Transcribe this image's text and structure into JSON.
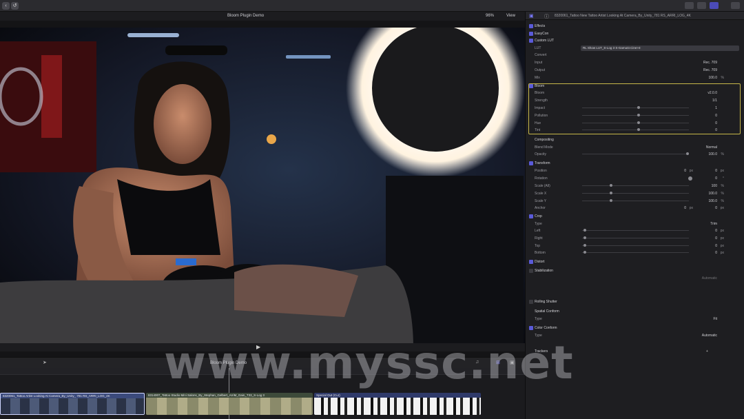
{
  "viewer": {
    "title": "Bloom Plugin Demo",
    "zoom": "96%",
    "view_label": "View"
  },
  "timeline": {
    "project_name": "Bloom Plugin Demo",
    "clips": [
      {
        "label": "8320061_Tattoo Artist Looking At Camera_By_Unity_ 781 RS_ARRI_LOG_4K"
      },
      {
        "label": "8314007_Tattoo Studio Mini Salons_By_Stephan_Gelbert_ArriM_Gain_T33_S-Log 3"
      },
      {
        "label": "Special Out (Cur)"
      }
    ]
  },
  "inspector": {
    "title": "8320061_Tattoo New Tattoo Artist Looking At Camera_By_Unity_781 RS_ARRI_LOG_4K",
    "effects_label": "Effects",
    "rows": {
      "easycon": "EasyCon",
      "custom_lut": "Custom LUT",
      "lut_label": "LUT",
      "lut_value": "RL Show LUT_S-Log 3 S-Gamut3.Cine>3",
      "convert": "Convert",
      "input_label": "Input",
      "input_value": "Rec. 709",
      "output_label": "Output",
      "output_value": "Rec. 709",
      "mix_label": "Mix",
      "mix_value": "100.0",
      "bloom_section": "Bloom",
      "bloom_label": "Bloom",
      "bloom_value": "v2.0.0",
      "strength_label": "Strength",
      "strength_value": "1/1",
      "impact_label": "Impact",
      "impact_value": "1",
      "pollution_label": "Pollution",
      "pollution_value": "0",
      "hue_label": "Hue",
      "hue_value": "0",
      "tint_label": "Tint",
      "tint_value": "0",
      "compositing": "Compositing",
      "blend_label": "Blend Mode",
      "blend_value": "Normal",
      "opacity_label": "Opacity",
      "opacity_value": "100.0",
      "transform": "Transform",
      "position_label": "Position",
      "position_x": "0",
      "position_y": "0",
      "rotation_label": "Rotation",
      "rotation_value": "0",
      "scale_all_label": "Scale (All)",
      "scale_all_value": "100",
      "scale_x_label": "Scale X",
      "scale_x_value": "100.0",
      "scale_y_label": "Scale Y",
      "scale_y_value": "100.0",
      "anchor_label": "Anchor",
      "anchor_x": "0",
      "anchor_y": "0",
      "crop": "Crop",
      "crop_type_label": "Type",
      "crop_type_value": "Trim",
      "left_label": "Left",
      "left_value": "0",
      "right_label": "Right",
      "right_value": "0",
      "top_label": "Top",
      "top_value": "0",
      "bottom_label": "Bottom",
      "bottom_value": "0",
      "distort": "Distort",
      "stabilization": "Stabilization",
      "stab_value": "Automatic",
      "rolling_shutter": "Rolling Shutter",
      "spatial_conform": "Spatial Conform",
      "spatial_type_label": "Type",
      "spatial_type_value": "Fit",
      "color_conform": "Color Conform",
      "color_type_label": "Type",
      "color_type_value": "Automatic",
      "trackers": "Trackers"
    },
    "units": {
      "percent": "%",
      "px": "px",
      "deg": "°"
    }
  },
  "watermark": "www.myssc.net",
  "colors": {
    "accent": "#5a5ad8",
    "highlight": "#c8b84a"
  }
}
